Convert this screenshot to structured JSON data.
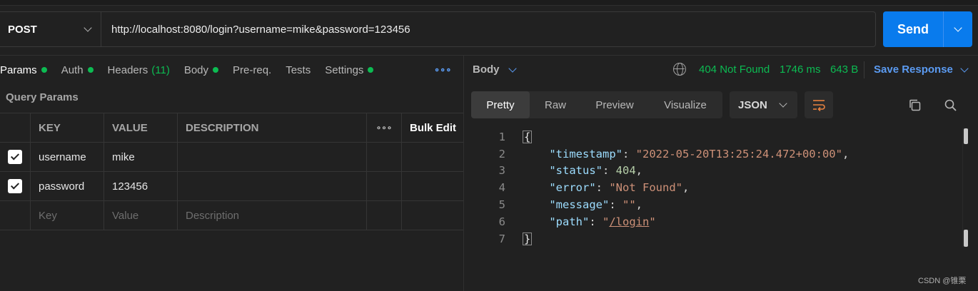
{
  "request": {
    "method": "POST",
    "url": "http://localhost:8080/login?username=mike&password=123456",
    "send_label": "Send"
  },
  "tabs": {
    "params": "Params",
    "auth": "Auth",
    "headers": "Headers",
    "headers_count": "(11)",
    "body": "Body",
    "prereq": "Pre-req.",
    "tests": "Tests",
    "settings": "Settings",
    "more": "∘∘∘"
  },
  "query_params": {
    "title": "Query Params",
    "columns": {
      "key": "KEY",
      "value": "VALUE",
      "description": "DESCRIPTION",
      "more": "∘∘∘",
      "bulk_edit": "Bulk Edit"
    },
    "rows": [
      {
        "checked": true,
        "key": "username",
        "value": "mike",
        "description": ""
      },
      {
        "checked": true,
        "key": "password",
        "value": "123456",
        "description": ""
      }
    ],
    "placeholders": {
      "key": "Key",
      "value": "Value",
      "description": "Description"
    }
  },
  "response": {
    "body_label": "Body",
    "status": "404 Not Found",
    "time": "1746 ms",
    "size": "643 B",
    "save_label": "Save Response",
    "view_tabs": [
      "Pretty",
      "Raw",
      "Preview",
      "Visualize"
    ],
    "active_view": "Pretty",
    "format": "JSON",
    "line_numbers": [
      "1",
      "2",
      "3",
      "4",
      "5",
      "6",
      "7"
    ],
    "json": {
      "open_brace": "{",
      "close_brace": "}",
      "timestamp_key": "\"timestamp\"",
      "timestamp_val": "\"2022-05-20T13:25:24.472+00:00\"",
      "status_key": "\"status\"",
      "status_val": "404",
      "error_key": "\"error\"",
      "error_val": "\"Not Found\"",
      "message_key": "\"message\"",
      "message_val": "\"\"",
      "path_key": "\"path\"",
      "path_q1": "\"",
      "path_val": "/login",
      "path_q2": "\""
    }
  },
  "watermark": "CSDN @锥栗",
  "colors": {
    "accent": "#097bed",
    "success": "#0cbb52",
    "link": "#5b9bf2",
    "background": "#212121"
  },
  "icons": [
    "chevron-down-icon",
    "globe-icon",
    "wrap-lines-icon",
    "copy-icon",
    "search-icon",
    "checkbox-checked-icon"
  ]
}
